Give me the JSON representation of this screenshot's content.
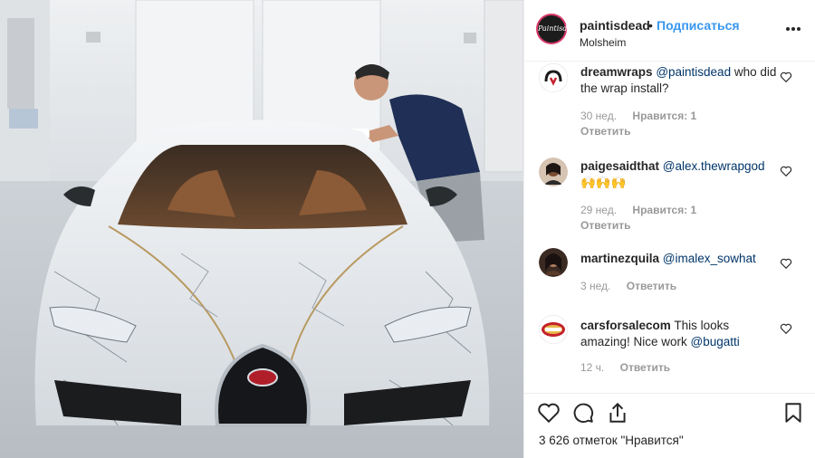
{
  "post": {
    "username": "paintisdead",
    "separator": "•",
    "follow_label": "Подписаться",
    "location": "Molsheim",
    "avatar_text": "Paintisdead",
    "more_label": "•••"
  },
  "comments": [
    {
      "user": "dreamwraps",
      "text_parts": [
        "@paintisdead",
        " who did the wrap install?"
      ],
      "time": "30 нед.",
      "likes": "Нравится: 1",
      "reply": "Ответить"
    },
    {
      "user": "paigesaidthat",
      "text_parts": [
        "@alex.thewrapgod",
        " 🙌🙌🙌"
      ],
      "time": "29 нед.",
      "likes": "Нравится: 1",
      "reply": "Ответить"
    },
    {
      "user": "martinezquila",
      "text_parts": [
        "@imalex_sowhat",
        ""
      ],
      "time": "3 нед.",
      "likes": "",
      "reply": "Ответить"
    },
    {
      "user": "carsforsalecom",
      "text_parts": [
        "This looks amazing! Nice work ",
        "@bugatti"
      ],
      "time": "12 ч.",
      "likes": "",
      "reply": "Ответить"
    }
  ],
  "footer": {
    "likes_text": "3 626 отметок \"Нравится\""
  },
  "icons": {
    "like": "heart-icon",
    "comment": "comment-icon",
    "share": "share-icon",
    "save": "bookmark-icon",
    "more": "more-icon"
  },
  "colors": {
    "accent": "#3897f0",
    "mention": "#003569",
    "muted": "#999999"
  }
}
